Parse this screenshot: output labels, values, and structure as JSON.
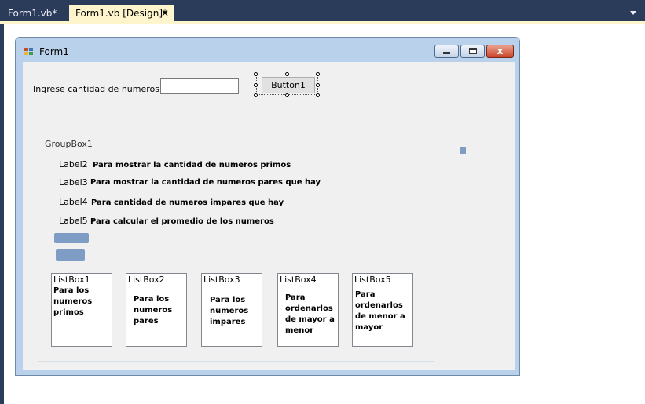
{
  "tabs": [
    {
      "label": "Form1.vb*"
    },
    {
      "label": "Form1.vb [Design]*"
    }
  ],
  "form": {
    "title": "Form1",
    "close_glyph": "x",
    "prompt_label": "Ingrese cantidad de numeros",
    "textbox_value": "",
    "button_label": "Button1",
    "groupbox": {
      "caption": "GroupBox1",
      "labels": [
        {
          "name": "Label2",
          "note": "Para mostrar la cantidad de numeros primos"
        },
        {
          "name": "Label3",
          "note": "Para mostrar la cantidad de numeros pares que hay"
        },
        {
          "name": "Label4",
          "note": "Para cantidad de numeros impares que hay"
        },
        {
          "name": "Label5",
          "note": "Para calcular el promedio de los numeros"
        }
      ],
      "listboxes": [
        {
          "name": "ListBox1",
          "note": "Para los numeros primos"
        },
        {
          "name": "ListBox2",
          "note": "Para los numeros pares"
        },
        {
          "name": "ListBox3",
          "note": "Para los numeros impares"
        },
        {
          "name": "ListBox4",
          "note": "Para ordenarlos de mayor a menor"
        },
        {
          "name": "ListBox5",
          "note": "Para ordenarlos de menor a mayor"
        }
      ]
    }
  },
  "colors": {
    "ide_background": "#2b3c5a",
    "active_tab": "#fff5cc",
    "form_border": "#b9d1ea",
    "client_area": "#f0f0f0",
    "selection_blob": "#7f9cc4"
  },
  "icons": {
    "tab_close": "close-icon",
    "overflow": "chevron-down-icon",
    "form": "form-app-icon"
  }
}
